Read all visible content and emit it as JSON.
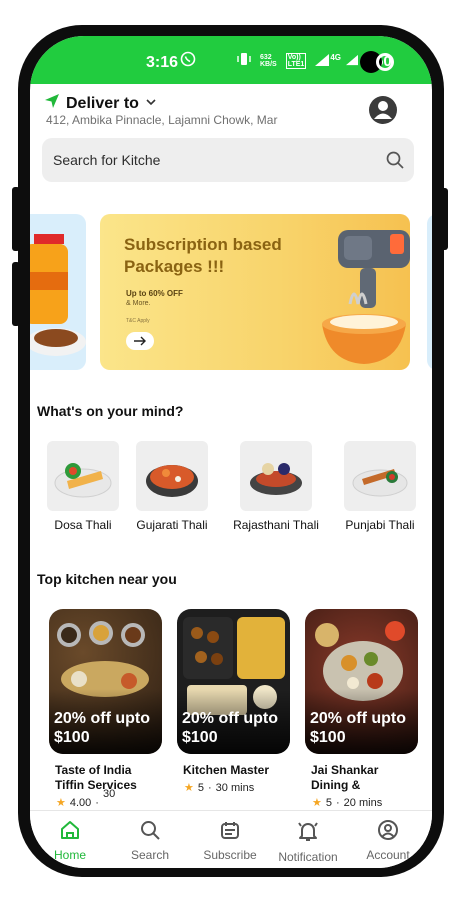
{
  "status_bar": {
    "time": "3:16",
    "speed_top": "632",
    "speed_bottom": "KB/S",
    "volte_top": "Vo))",
    "volte_bottom": "LTE1",
    "network": "4G",
    "battery": "50"
  },
  "header": {
    "deliver_title": "Deliver to",
    "address": "412, Ambika Pinnacle, Lajamni Chowk, Mar"
  },
  "search": {
    "placeholder": "Search for Kitche"
  },
  "banner": {
    "title": "Subscription based Packages !!!",
    "offer": "Up to 60% OFF",
    "more": "& More.",
    "tc": "T&C Apply"
  },
  "categories": {
    "title": "What's on your mind?",
    "items": [
      {
        "label": "Dosa Thali"
      },
      {
        "label": "Gujarati Thali"
      },
      {
        "label": "Rajasthani Thali"
      },
      {
        "label": "Punjabi Thali"
      }
    ]
  },
  "kitchens": {
    "title": "Top kitchen near you",
    "items": [
      {
        "offer": "20% off upto $100",
        "name": "Taste of India Tiffin Services",
        "rating": "4.00",
        "time": "30"
      },
      {
        "offer": "20% off upto $100",
        "name": "Kitchen Master",
        "rating": "5",
        "time": "30 mins"
      },
      {
        "offer": "20% off upto $100",
        "name": "Jai Shankar Dining &",
        "rating": "5",
        "time": "20 mins"
      }
    ]
  },
  "bottom_nav": {
    "items": [
      {
        "label": "Home",
        "icon": "home-icon"
      },
      {
        "label": "Search",
        "icon": "search-icon"
      },
      {
        "label": "Subscribe",
        "icon": "calendar-icon"
      },
      {
        "label": "Notification",
        "icon": "bell-icon"
      },
      {
        "label": "Account",
        "icon": "account-icon"
      }
    ]
  },
  "colors": {
    "brand_green": "#21cc3f",
    "banner_yellow": "#f8d36a",
    "star": "#f5a623"
  }
}
